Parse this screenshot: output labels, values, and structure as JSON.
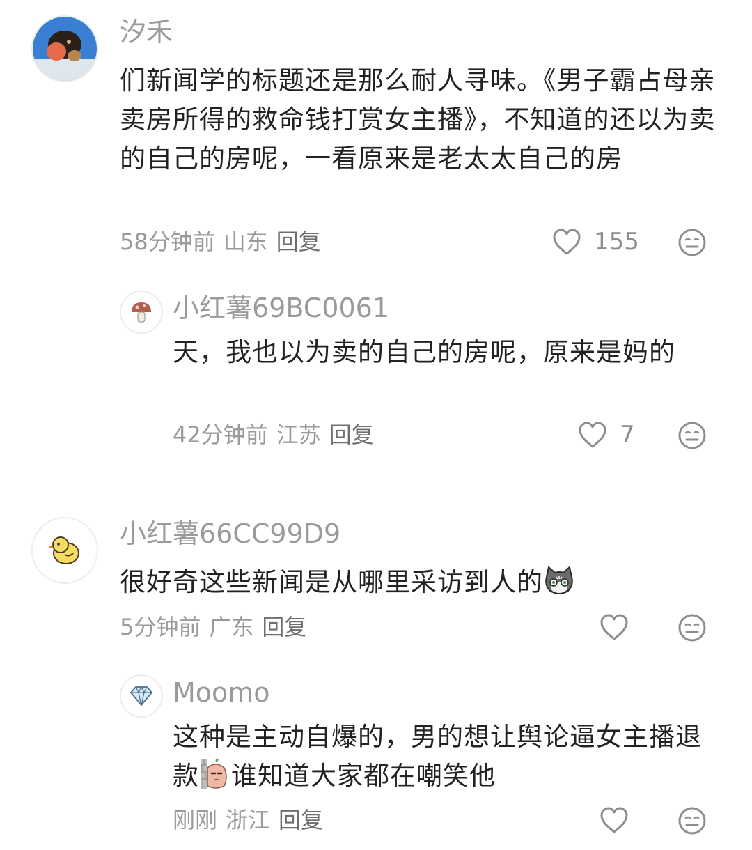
{
  "comments": [
    {
      "avatar_icon": "dog-with-peach-avatar",
      "name": "汐禾",
      "text": "们新闻学的标题还是那么耐人寻味。《男子霸占母亲卖房所得的救命钱打赏女主播》，不知道的还以为卖的自己的房呢，一看原来是老太太自己的房",
      "time": "58分钟前",
      "location": "山东",
      "reply_label": "回复",
      "likes": "155",
      "replies": [
        {
          "avatar_icon": "mushroom-avatar",
          "name": "小红薯69BC0061",
          "text": "天，我也以为卖的自己的房呢，原来是妈的",
          "time": "42分钟前",
          "location": "江苏",
          "reply_label": "回复",
          "likes": "7"
        }
      ]
    },
    {
      "avatar_icon": "chick-avatar",
      "name": "小红薯66CC99D9",
      "text": "很好奇这些新闻是从哪里采访到人的",
      "text_emoji": "cat-face-emoji",
      "time": "5分钟前",
      "location": "广东",
      "reply_label": "回复",
      "likes": "",
      "replies": [
        {
          "avatar_icon": "diamond-avatar",
          "name": "Moomo",
          "text_before_emoji": "这种是主动自爆的，男的想让舆论逼女主播退款",
          "text_emoji": "peeking-potato-emoji",
          "text_after_emoji": "谁知道大家都在嘲笑他",
          "time": "刚刚",
          "location": "浙江",
          "reply_label": "回复",
          "likes": ""
        }
      ]
    }
  ],
  "icons": {
    "like": "heart-outline-icon",
    "dislike": "meh-face-icon"
  },
  "colors": {
    "meta_text": "#9a9a9a",
    "body_text": "#222222",
    "icon_stroke": "#8d8d8d"
  }
}
